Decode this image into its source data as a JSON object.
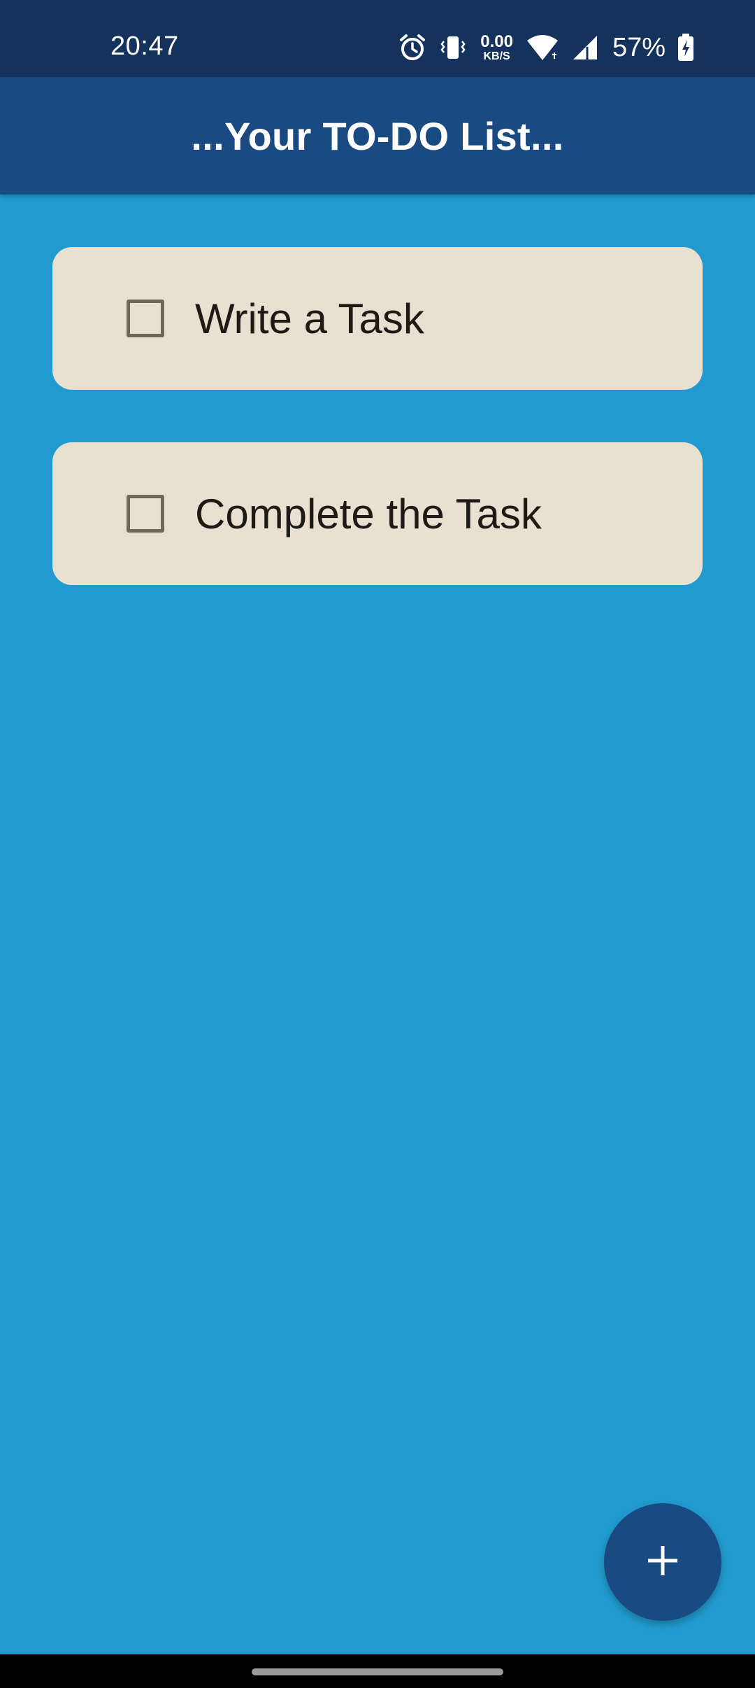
{
  "status_bar": {
    "time": "20:47",
    "net_speed_value": "0.00",
    "net_speed_unit": "KB/S",
    "battery_percent": "57%",
    "icons": [
      "alarm-icon",
      "vibrate-icon",
      "wifi-icon",
      "signal-icon",
      "battery-charging-icon"
    ]
  },
  "app_bar": {
    "title": "...Your TO-DO List..."
  },
  "tasks": [
    {
      "label": "Write a Task",
      "checked": false
    },
    {
      "label": "Complete the Task",
      "checked": false
    }
  ],
  "fab": {
    "icon": "plus-icon"
  },
  "colors": {
    "background": "#219bcf",
    "status_bar": "#14325c",
    "app_bar": "#1a4a82",
    "card": "#e8e0d0",
    "fab": "#1a4a82"
  }
}
